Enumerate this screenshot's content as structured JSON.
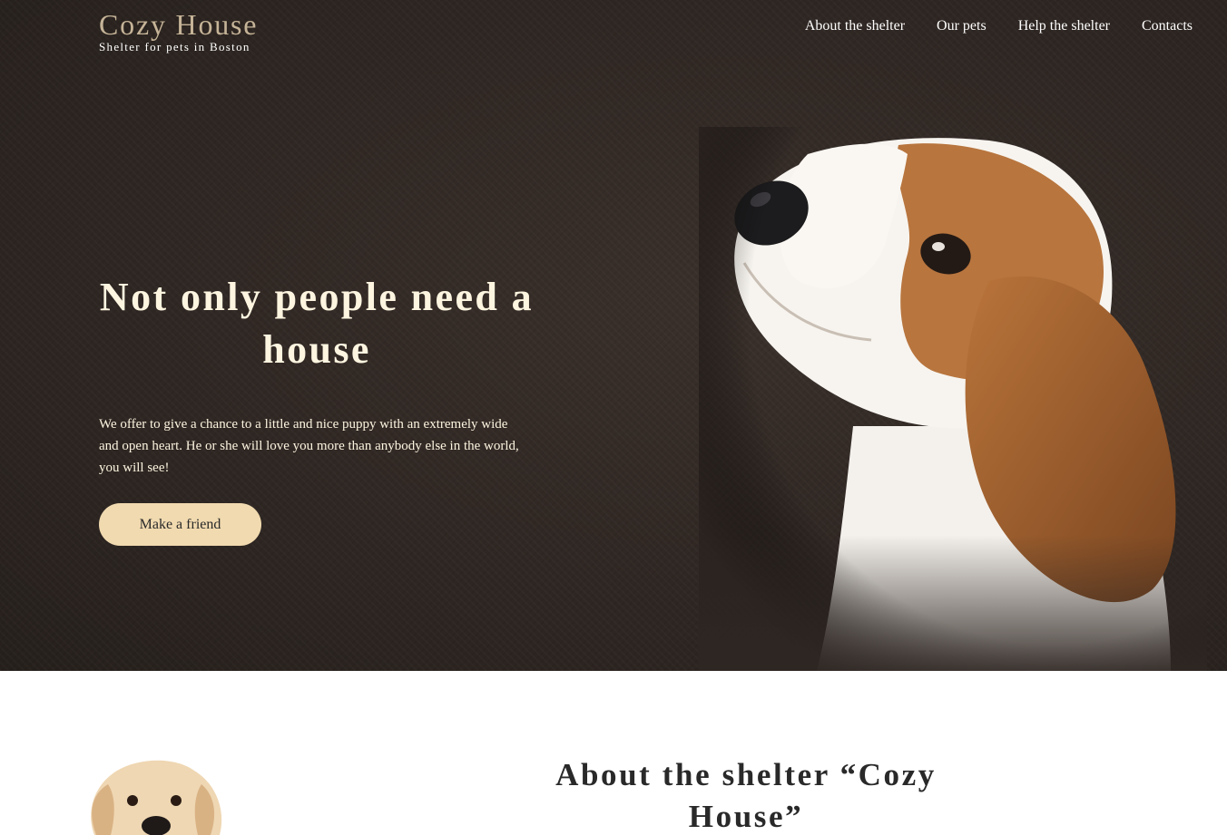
{
  "header": {
    "logo_title": "Cozy House",
    "logo_subtitle": "Shelter for pets in Boston",
    "nav": [
      {
        "label": "About the shelter"
      },
      {
        "label": "Our pets"
      },
      {
        "label": "Help the shelter"
      },
      {
        "label": "Contacts"
      }
    ]
  },
  "hero": {
    "title": "Not only people need a house",
    "text": "We offer to give a chance to a little and nice puppy with an extremely wide and open heart. He or she will love you more than anybody else in the world, you will see!",
    "button_label": "Make a friend",
    "image": "beagle-puppy-photo"
  },
  "about": {
    "title": "About the shelter “Cozy House”",
    "image": "golden-retriever-puppy-photo"
  },
  "colors": {
    "hero_background": "#2f2723",
    "logo_title": "#c6b498",
    "hero_text": "#fdf5e0",
    "button_background": "#f1daaf",
    "section_background": "#ffffff",
    "dark_text": "#292929"
  }
}
